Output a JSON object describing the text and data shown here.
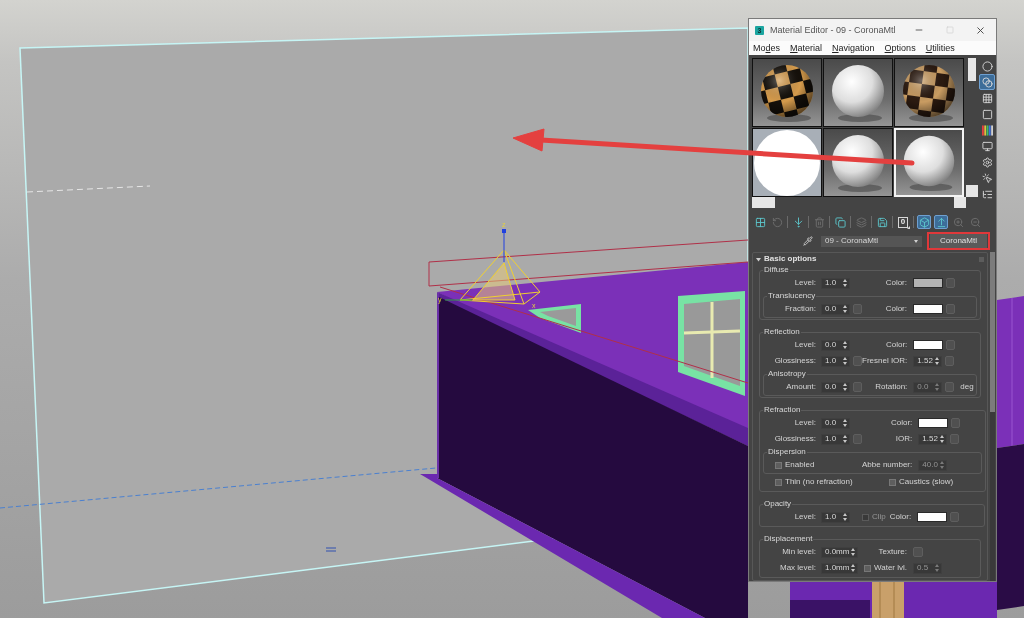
{
  "viewport": {
    "gizmo_axes": [
      "z",
      "y",
      "x"
    ]
  },
  "window": {
    "icon_text": "3",
    "title": "Material Editor - 09 - CoronaMtl",
    "maximize_disabled": true
  },
  "menu": [
    {
      "pre": "Mo",
      "key": "d",
      "post": "es"
    },
    {
      "key": "M",
      "post": "aterial"
    },
    {
      "key": "N",
      "post": "avigation"
    },
    {
      "key": "O",
      "post": "ptions"
    },
    {
      "key": "U",
      "post": "tilities"
    }
  ],
  "sample_slots": [
    {
      "kind": "checker",
      "selected": false
    },
    {
      "kind": "plain",
      "selected": false
    },
    {
      "kind": "wood-checker",
      "selected": false
    },
    {
      "kind": "flat",
      "selected": false
    },
    {
      "kind": "plain",
      "selected": false
    },
    {
      "kind": "plain",
      "selected": true
    }
  ],
  "side_tools": [
    {
      "active": false
    },
    {
      "active": true
    },
    {
      "active": false
    },
    {
      "active": false
    },
    {
      "active": false
    },
    {
      "active": false
    },
    {
      "active": false
    },
    {
      "active": false
    },
    {
      "active": false
    }
  ],
  "toolbar": [
    {
      "active": false,
      "disabled": false
    },
    {
      "active": false,
      "disabled": true
    },
    {
      "active": false,
      "disabled": false
    },
    {
      "active": false,
      "disabled": true
    },
    {
      "active": false,
      "disabled": false
    },
    {
      "active": false,
      "disabled": true
    },
    {
      "active": false,
      "disabled": false
    },
    {
      "active": false,
      "disabled": false,
      "label": "0"
    },
    {
      "active": true,
      "disabled": false
    },
    {
      "active": true,
      "disabled": false
    },
    {
      "active": false,
      "disabled": true
    },
    {
      "active": false,
      "disabled": true
    }
  ],
  "material_select": {
    "value": "09 - CoronaMtl"
  },
  "type_button": {
    "label": "CoronaMtl",
    "outlined": true
  },
  "rollout": {
    "title": "Basic options",
    "expanded": true,
    "groups": [
      {
        "title": "Diffuse",
        "items": [
          {
            "kind": "row",
            "fields": [
              {
                "kind": "spinner",
                "label": "Level:",
                "value": "1.0",
                "map": false,
                "disabled": false
              },
              {
                "kind": "color",
                "label": "Color:",
                "color": "#b4b4b4",
                "map": true
              }
            ]
          },
          {
            "kind": "subgroup",
            "title": "Translucency",
            "items": [
              {
                "kind": "row",
                "fields": [
                  {
                    "kind": "spinner",
                    "label": "Fraction:",
                    "value": "0.0",
                    "map": true,
                    "disabled": false
                  },
                  {
                    "kind": "color",
                    "label": "Color:",
                    "color": "#ffffff",
                    "map": true
                  }
                ]
              }
            ]
          }
        ]
      },
      {
        "title": "Reflection",
        "items": [
          {
            "kind": "row",
            "fields": [
              {
                "kind": "spinner",
                "label": "Level:",
                "value": "0.0",
                "map": false,
                "disabled": false
              },
              {
                "kind": "color",
                "label": "Color:",
                "color": "#ffffff",
                "map": true
              }
            ]
          },
          {
            "kind": "row",
            "fields": [
              {
                "kind": "spinner",
                "label": "Glossiness:",
                "value": "1.0",
                "map": true,
                "disabled": false
              },
              {
                "kind": "spinner",
                "label": "Fresnel IOR:",
                "value": "1.52",
                "map": true,
                "disabled": false
              }
            ]
          },
          {
            "kind": "subgroup",
            "title": "Anisotropy",
            "items": [
              {
                "kind": "row",
                "fields": [
                  {
                    "kind": "spinner",
                    "label": "Amount:",
                    "value": "0.0",
                    "map": true,
                    "disabled": false
                  },
                  {
                    "kind": "spinner",
                    "label": "Rotation:",
                    "value": "0.0",
                    "map": true,
                    "disabled": true,
                    "unit": "deg"
                  }
                ]
              }
            ]
          }
        ]
      },
      {
        "title": "Refraction",
        "items": [
          {
            "kind": "row",
            "fields": [
              {
                "kind": "spinner",
                "label": "Level:",
                "value": "0.0",
                "map": false,
                "disabled": false
              },
              {
                "kind": "color",
                "label": "Color:",
                "color": "#ffffff",
                "map": true
              }
            ]
          },
          {
            "kind": "row",
            "fields": [
              {
                "kind": "spinner",
                "label": "Glossiness:",
                "value": "1.0",
                "map": true,
                "disabled": false
              },
              {
                "kind": "spinner",
                "label": "IOR:",
                "value": "1.52",
                "map": true,
                "disabled": false
              }
            ]
          },
          {
            "kind": "subgroup",
            "title": "Dispersion",
            "items": [
              {
                "kind": "row",
                "fields": [
                  {
                    "kind": "checkbox",
                    "label": "Enabled",
                    "checked": false,
                    "disabled": false
                  },
                  {
                    "kind": "spinner",
                    "label": "Abbe number:",
                    "value": "40.0",
                    "map": false,
                    "disabled": true
                  }
                ]
              }
            ]
          },
          {
            "kind": "checks",
            "fields": [
              {
                "kind": "checkbox",
                "label": "Thin (no refraction)",
                "checked": false,
                "disabled": false
              },
              {
                "kind": "checkbox",
                "label": "Caustics (slow)",
                "checked": false,
                "disabled": false
              }
            ]
          }
        ]
      },
      {
        "title": "Opacity",
        "items": [
          {
            "kind": "row",
            "fields": [
              {
                "kind": "spinner",
                "label": "Level:",
                "value": "1.0",
                "map": false,
                "disabled": false
              },
              {
                "kind": "checkbox",
                "label": "Clip",
                "checked": false,
                "disabled": true
              },
              {
                "kind": "color",
                "label": "Color:",
                "color": "#ffffff",
                "map": true
              }
            ]
          }
        ]
      },
      {
        "title": "Displacement",
        "items": [
          {
            "kind": "row",
            "fields": [
              {
                "kind": "spinner",
                "label": "Min level:",
                "value": "0.0mm",
                "map": false,
                "disabled": false
              },
              {
                "kind": "map",
                "label": "Texture:"
              }
            ]
          },
          {
            "kind": "row",
            "fields": [
              {
                "kind": "spinner",
                "label": "Max level:",
                "value": "1.0mm",
                "map": false,
                "disabled": false
              },
              {
                "kind": "checkspinner",
                "label": "Water lvl.",
                "checked": false,
                "value": "0.5",
                "map": false,
                "disabled": true
              }
            ]
          }
        ]
      }
    ]
  }
}
